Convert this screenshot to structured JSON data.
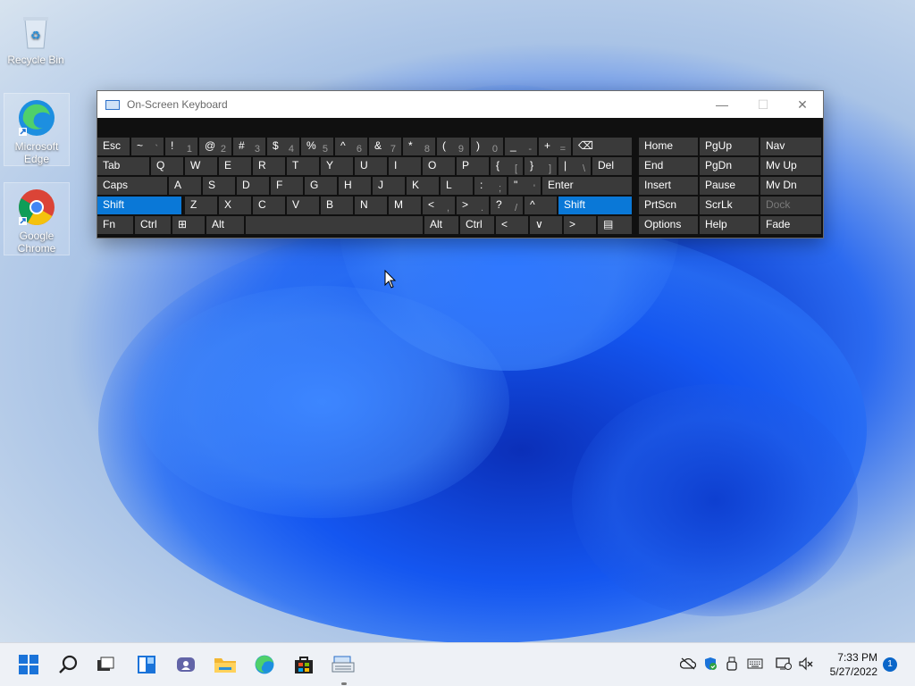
{
  "desktop": {
    "icons": [
      {
        "label": "Recycle Bin"
      },
      {
        "label": "Microsoft Edge"
      },
      {
        "label": "Google Chrome"
      }
    ]
  },
  "osk": {
    "title": "On-Screen Keyboard",
    "controls": {
      "minimize": "—",
      "maximize": "☐",
      "close": "✕"
    },
    "rows": [
      [
        {
          "label": "Esc"
        },
        {
          "label": "~",
          "sub": "`"
        },
        {
          "label": "!",
          "sub": "1"
        },
        {
          "label": "@",
          "sub": "2"
        },
        {
          "label": "#",
          "sub": "3"
        },
        {
          "label": "$",
          "sub": "4"
        },
        {
          "label": "%",
          "sub": "5"
        },
        {
          "label": "^",
          "sub": "6"
        },
        {
          "label": "&",
          "sub": "7"
        },
        {
          "label": "*",
          "sub": "8"
        },
        {
          "label": "(",
          "sub": "9"
        },
        {
          "label": ")",
          "sub": "0"
        },
        {
          "label": "_",
          "sub": "-"
        },
        {
          "label": "+",
          "sub": "="
        },
        {
          "label": "⌫"
        }
      ],
      [
        {
          "label": "Tab"
        },
        {
          "label": "Q"
        },
        {
          "label": "W"
        },
        {
          "label": "E"
        },
        {
          "label": "R"
        },
        {
          "label": "T"
        },
        {
          "label": "Y"
        },
        {
          "label": "U"
        },
        {
          "label": "I"
        },
        {
          "label": "O"
        },
        {
          "label": "P"
        },
        {
          "label": "{",
          "sub": "["
        },
        {
          "label": "}",
          "sub": "]"
        },
        {
          "label": "|",
          "sub": "\\"
        },
        {
          "label": "Del"
        }
      ],
      [
        {
          "label": "Caps"
        },
        {
          "label": "A"
        },
        {
          "label": "S"
        },
        {
          "label": "D"
        },
        {
          "label": "F"
        },
        {
          "label": "G"
        },
        {
          "label": "H"
        },
        {
          "label": "J"
        },
        {
          "label": "K"
        },
        {
          "label": "L"
        },
        {
          "label": ":",
          "sub": ";"
        },
        {
          "label": "\"",
          "sub": "'"
        },
        {
          "label": "Enter"
        }
      ],
      [
        {
          "label": "Shift"
        },
        {
          "label": "Z"
        },
        {
          "label": "X"
        },
        {
          "label": "C"
        },
        {
          "label": "V"
        },
        {
          "label": "B"
        },
        {
          "label": "N"
        },
        {
          "label": "M"
        },
        {
          "label": "<",
          "sub": ","
        },
        {
          "label": ">",
          "sub": "."
        },
        {
          "label": "?",
          "sub": "/"
        },
        {
          "label": "^"
        },
        {
          "label": "Shift"
        }
      ],
      [
        {
          "label": "Fn"
        },
        {
          "label": "Ctrl"
        },
        {
          "label": "⊞"
        },
        {
          "label": "Alt"
        },
        {
          "label": ""
        },
        {
          "label": "Alt"
        },
        {
          "label": "Ctrl"
        },
        {
          "label": "<"
        },
        {
          "label": "∨"
        },
        {
          "label": ">"
        },
        {
          "label": "▤"
        }
      ]
    ],
    "nav_rows": [
      [
        {
          "label": "Home"
        },
        {
          "label": "PgUp"
        },
        {
          "label": "Nav"
        }
      ],
      [
        {
          "label": "End"
        },
        {
          "label": "PgDn"
        },
        {
          "label": "Mv Up"
        }
      ],
      [
        {
          "label": "Insert"
        },
        {
          "label": "Pause"
        },
        {
          "label": "Mv Dn"
        }
      ],
      [
        {
          "label": "PrtScn"
        },
        {
          "label": "ScrLk"
        },
        {
          "label": "Dock"
        }
      ],
      [
        {
          "label": "Options"
        },
        {
          "label": "Help"
        },
        {
          "label": "Fade"
        }
      ]
    ]
  },
  "taskbar": {
    "apps": [
      {
        "icon": "start-icon"
      },
      {
        "icon": "search-icon"
      },
      {
        "icon": "task-view-icon"
      },
      {
        "icon": "widgets-icon"
      },
      {
        "icon": "chat-icon"
      },
      {
        "icon": "file-explorer-icon"
      },
      {
        "icon": "edge-icon"
      },
      {
        "icon": "store-icon"
      },
      {
        "icon": "on-screen-keyboard-icon"
      }
    ],
    "time": "7:33 PM",
    "date": "5/27/2022",
    "notification_count": "1"
  },
  "colors": {
    "accent": "#0a78d7",
    "key": "#3a3a3a"
  }
}
